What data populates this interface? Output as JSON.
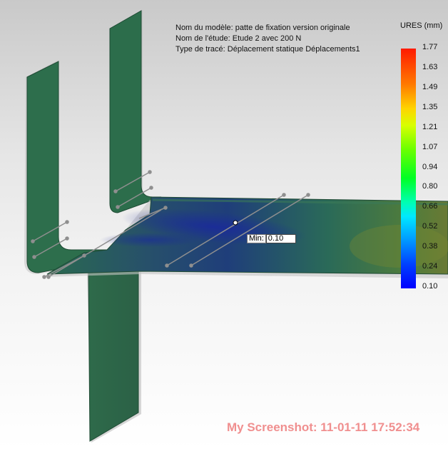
{
  "study_info": {
    "model_line": "Nom du modèle: patte de fixation version originale",
    "study_line": "Nom de l'étude: Etude 2 avec 200 N",
    "plot_line": "Type de tracé: Déplacement statique Déplacements1"
  },
  "legend": {
    "title": "URES (mm)",
    "ticks": [
      "1.77",
      "1.63",
      "1.49",
      "1.35",
      "1.21",
      "1.07",
      "0.94",
      "0.80",
      "0.66",
      "0.52",
      "0.38",
      "0.24",
      "0.10"
    ],
    "color_max": "#ff1a00",
    "color_min": "#0000ff"
  },
  "probe": {
    "label": "Min:",
    "value": "0.10"
  },
  "watermark": "My Screenshot: 11-01-11 17:52:34",
  "colors": {
    "part_green": "#2f6e4c",
    "edge_gray": "#9a9a9a",
    "stamp": "#f08f8f"
  }
}
